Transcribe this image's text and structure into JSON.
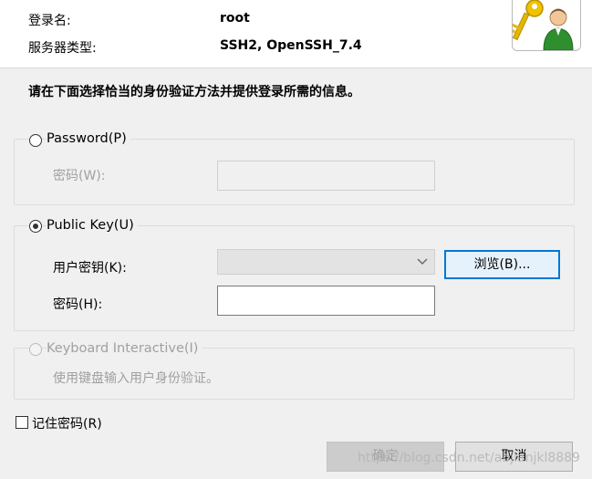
{
  "header": {
    "login_label": "登录名:",
    "login_value": "root",
    "server_type_label": "服务器类型:",
    "server_type_value": "SSH2, OpenSSH_7.4",
    "avatar_icon": "user-key-icon"
  },
  "instruction": "请在下面选择恰当的身份验证方法并提供登录所需的信息。",
  "password_group": {
    "label": "Password(P)",
    "selected": false,
    "password_label": "密码(W):",
    "password_value": ""
  },
  "publickey_group": {
    "label": "Public Key(U)",
    "selected": true,
    "user_key_label": "用户密钥(K):",
    "user_key_value": "",
    "browse_label": "浏览(B)...",
    "passphrase_label": "密码(H):",
    "passphrase_value": ""
  },
  "keyboard_group": {
    "label": "Keyboard Interactive(I)",
    "selected": false,
    "enabled": false,
    "description": "使用键盘输入用户身份验证。"
  },
  "remember": {
    "label": "记住密码(R)",
    "checked": false
  },
  "buttons": {
    "ok_label": "确定",
    "cancel_label": "取消"
  },
  "watermark": "https://blog.csdn.net/abjianjkl8889",
  "colors": {
    "background": "#f0f0f0",
    "accent": "#0078d7",
    "disabled_text": "#a0a0a0"
  }
}
